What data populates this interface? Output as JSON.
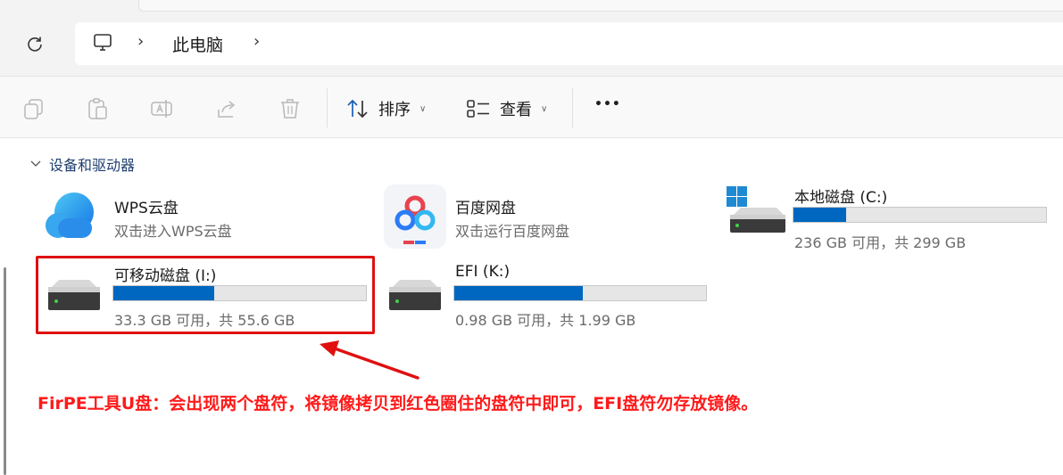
{
  "breadcrumb": {
    "current": "此电脑"
  },
  "toolbar": {
    "sort_label": "排序",
    "view_label": "查看",
    "more_label": "•••"
  },
  "group": {
    "title": "设备和驱动器"
  },
  "items": [
    {
      "name": "WPS云盘",
      "sub": "双击进入WPS云盘"
    },
    {
      "name": "百度网盘",
      "sub": "双击运行百度网盘"
    },
    {
      "name": "本地磁盘 (C:)",
      "sub": "236 GB 可用，共 299 GB",
      "used_fraction": 0.21
    },
    {
      "name": "可移动磁盘 (I:)",
      "sub": "33.3 GB 可用，共 55.6 GB",
      "used_fraction": 0.4
    },
    {
      "name": "EFI (K:)",
      "sub": "0.98 GB 可用，共 1.99 GB",
      "used_fraction": 0.51
    }
  ],
  "annotation": {
    "text": "FirPE工具U盘：会出现两个盘符，将镜像拷贝到红色圈住的盘符中即可，EFI盘符勿存放镜像。"
  },
  "colors": {
    "accent": "#0067c0",
    "highlight": "#e01010",
    "annotation": "#ff1a1a"
  }
}
